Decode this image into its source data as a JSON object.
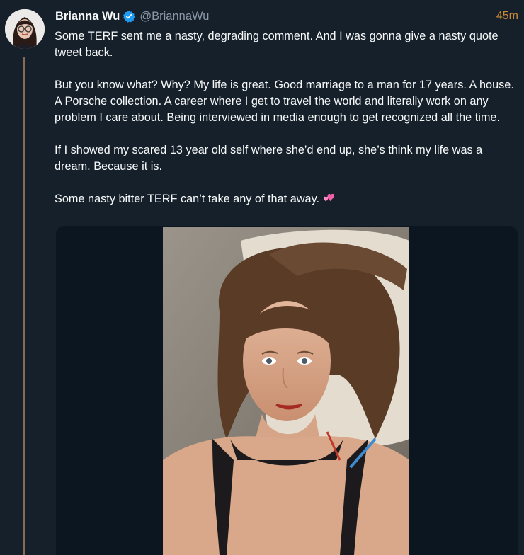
{
  "tweet": {
    "author": {
      "display_name": "Brianna Wu",
      "handle": "@BriannaWu",
      "verified": true,
      "avatar_alt": "profile photo"
    },
    "timestamp": "45m",
    "paragraphs": [
      "Some TERF sent me a nasty, degrading comment. And I was gonna give a nasty quote tweet back.",
      "But you know what? Why? My life is great. Good marriage to a man for 17 years. A house. A Porsche collection. A career where I get to travel the world and literally work on any problem I care about. Being interviewed in media enough to get recognized all the time.",
      "If I showed my scared 13 year old self where she’d end up, she’s think my life was a dream. Because it is.",
      "Some nasty bitter TERF can’t take any of that away."
    ],
    "emoji": "two-hearts-emoji",
    "media": {
      "type": "photo"
    }
  },
  "colors": {
    "background": "#15202b",
    "text": "#f7f9f9",
    "secondary_text": "#8b98a5",
    "timestamp": "#c98a36",
    "verified": "#1d9bf0",
    "thread_line": "#8a6a55",
    "emoji": "#f25fa8"
  }
}
